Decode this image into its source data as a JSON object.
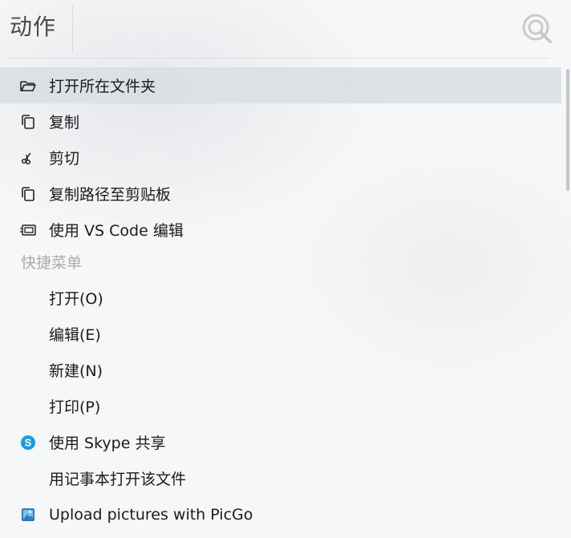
{
  "header": {
    "title": "动作",
    "search_icon": "search-icon"
  },
  "actions": [
    {
      "label": "打开所在文件夹",
      "icon": "folder-open-icon",
      "selected": true
    },
    {
      "label": "复制",
      "icon": "copy-icon"
    },
    {
      "label": "剪切",
      "icon": "scissors-icon"
    },
    {
      "label": "复制路径至剪贴板",
      "icon": "copy-path-icon"
    },
    {
      "label": "使用 VS Code 编辑",
      "icon": "vscode-icon"
    }
  ],
  "quick_menu": {
    "section_label": "快捷菜单",
    "items": [
      {
        "label": "打开(O)",
        "icon": ""
      },
      {
        "label": "编辑(E)",
        "icon": ""
      },
      {
        "label": "新建(N)",
        "icon": ""
      },
      {
        "label": "打印(P)",
        "icon": ""
      },
      {
        "label": "使用 Skype 共享",
        "icon": "skype-icon",
        "icon_color": "#1a9be6"
      },
      {
        "label": "用记事本打开该文件",
        "icon": ""
      },
      {
        "label": "Upload pictures with PicGo",
        "icon": "picgo-icon",
        "icon_color": "#2e7ec4"
      }
    ]
  },
  "colors": {
    "selected_row": "#dbdee3",
    "section_text": "#a9abae",
    "text": "#1b1b1b",
    "title": "#4a4a4a"
  }
}
